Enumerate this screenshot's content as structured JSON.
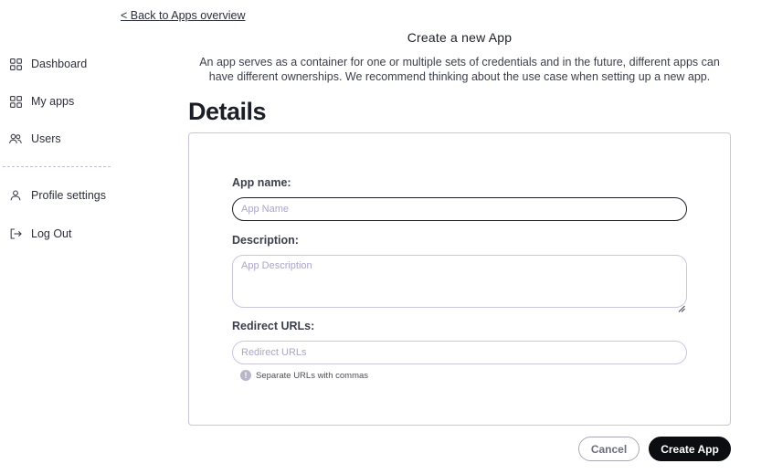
{
  "sidebar": {
    "items": [
      {
        "label": "Dashboard",
        "icon": "grid-icon"
      },
      {
        "label": "My apps",
        "icon": "grid-icon"
      },
      {
        "label": "Users",
        "icon": "users-icon"
      },
      {
        "label": "Profile settings",
        "icon": "user-icon"
      },
      {
        "label": "Log Out",
        "icon": "logout-icon"
      }
    ]
  },
  "main": {
    "back_link": "< Back to Apps overview",
    "title": "Create a new App",
    "intro_line1": "An app serves as a container for one or multiple sets of credentials and in the future, different apps can",
    "intro_line2": "have different ownerships. We recommend thinking about the use case when setting up a new app.",
    "section_heading": "Details"
  },
  "form": {
    "app_name": {
      "label": "App name:",
      "placeholder": "App Name",
      "value": ""
    },
    "description": {
      "label": "Description:",
      "placeholder": "App Description",
      "value": ""
    },
    "redirect_urls": {
      "label": "Redirect URLs:",
      "placeholder": "Redirect URLs",
      "value": "",
      "hint": "Separate URLs with commas"
    }
  },
  "actions": {
    "cancel_label": "Cancel",
    "create_label": "Create App"
  },
  "colors": {
    "accent_border": "#c9c6e0",
    "primary_button": "#0c0d10",
    "placeholder": "#a9a6c8"
  }
}
